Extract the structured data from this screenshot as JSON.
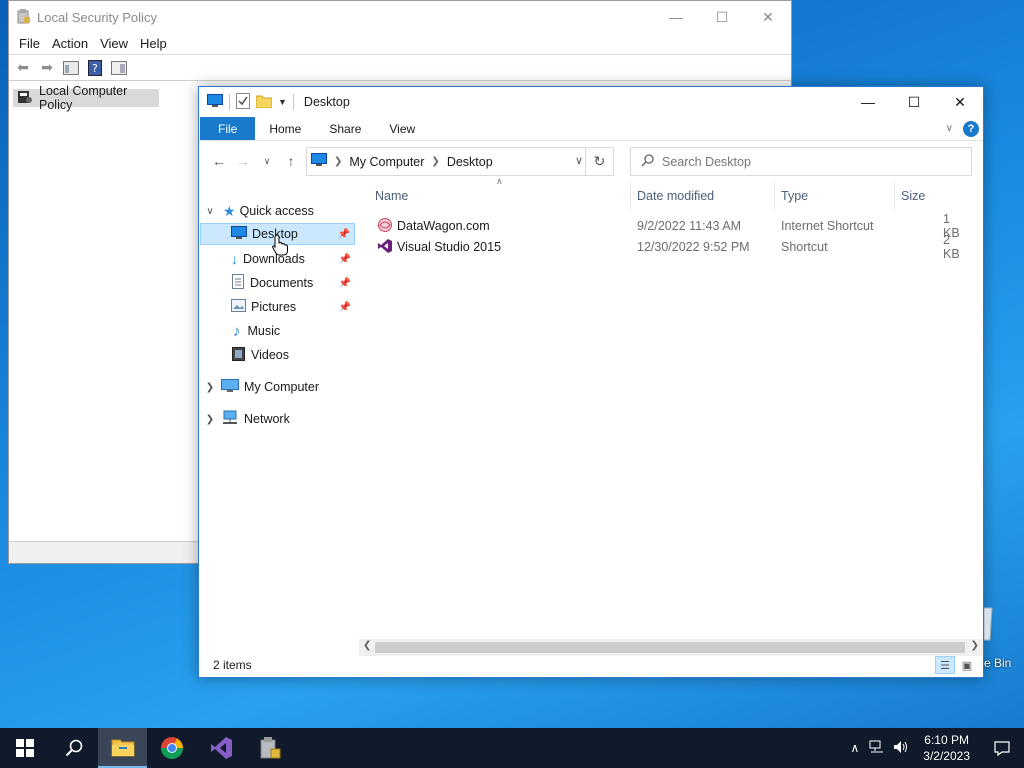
{
  "lsp": {
    "title": "Local Security Policy",
    "menu": [
      "File",
      "Action",
      "View",
      "Help"
    ],
    "tree_root": "Local Computer Policy"
  },
  "explorer": {
    "title": "Desktop",
    "ribbon_tabs": [
      "File",
      "Home",
      "Share",
      "View"
    ],
    "address": [
      "My Computer",
      "Desktop"
    ],
    "search_placeholder": "Search Desktop",
    "nav": {
      "quick_access": "Quick access",
      "items": [
        "Desktop",
        "Downloads",
        "Documents",
        "Pictures",
        "Music",
        "Videos"
      ],
      "my_computer": "My Computer",
      "network": "Network"
    },
    "columns": [
      "Name",
      "Date modified",
      "Type",
      "Size"
    ],
    "files": [
      {
        "name": "DataWagon.com",
        "date": "9/2/2022 11:43 AM",
        "type": "Internet Shortcut",
        "size": "1 KB"
      },
      {
        "name": "Visual Studio 2015",
        "date": "12/30/2022 9:52 PM",
        "type": "Shortcut",
        "size": "2 KB"
      }
    ],
    "status": "2 items"
  },
  "desktop": {
    "recycle_label": "e Bin"
  },
  "taskbar": {
    "time": "6:10 PM",
    "date": "3/2/2023"
  },
  "colors": {
    "accent": "#1979ca",
    "selection": "#cce8ff",
    "taskbar": "#101a2a"
  }
}
